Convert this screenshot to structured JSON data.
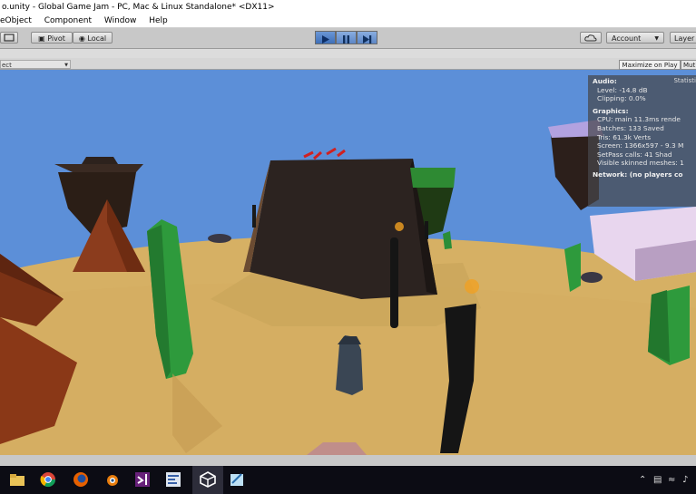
{
  "window": {
    "title": "o.unity - Global Game Jam - PC, Mac & Linux Standalone* <DX11>"
  },
  "menu": {
    "items": [
      "eObject",
      "Component",
      "Window",
      "Help"
    ]
  },
  "toolbar": {
    "pivot_label": "Pivot",
    "local_label": "Local",
    "account_label": "Account",
    "layers_label": "Layer"
  },
  "game_view": {
    "aspect_label": "ect",
    "maximize_label": "Maximize on Play",
    "mute_label": "Mut"
  },
  "statistics": {
    "title": "Statisti",
    "audio_header": "Audio:",
    "level": "Level: -14.8 dB",
    "clipping": "Clipping: 0.0%",
    "graphics_header": "Graphics:",
    "cpu": "CPU: main 11.3ms  rende",
    "batches": "Batches: 133        Saved",
    "tris": "Tris: 61.3k           Verts",
    "screen": "Screen: 1366x597 - 9.3 M",
    "setpass": "SetPass calls: 41      Shad",
    "skinned": "Visible skinned meshes: 1",
    "network": "Network: (no players co"
  },
  "colors": {
    "sky": "#5c8fd8",
    "sand": "#d9b465",
    "cactus": "#2f9a3e",
    "rock_brown": "#7e3216",
    "mesa": "#2b221f",
    "play_active": "#3e6fb8"
  },
  "taskbar": {
    "icons": [
      "file-explorer-icon",
      "chrome-icon",
      "firefox-icon",
      "blender-icon",
      "visual-studio-icon",
      "mono-editor-icon",
      "unity-icon",
      "notepad-icon"
    ]
  }
}
